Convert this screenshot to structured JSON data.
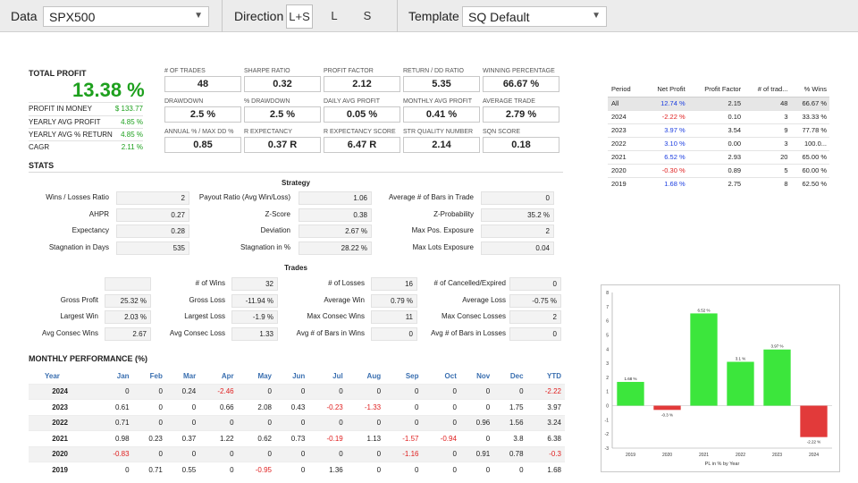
{
  "toolbar": {
    "data_label": "Data",
    "data_value": "SPX500",
    "direction_label": "Direction",
    "direction_options": [
      "L+S",
      "L",
      "S"
    ],
    "template_label": "Template",
    "template_value": "SQ Default"
  },
  "summary": {
    "total_profit_label": "TOTAL PROFIT",
    "total_profit_value": "13.38 %",
    "rows": [
      {
        "label": "PROFIT IN MONEY",
        "value": "$ 133.77"
      },
      {
        "label": "YEARLY AVG PROFIT",
        "value": "4.85 %"
      },
      {
        "label": "YEARLY AVG % RETURN",
        "value": "4.85 %"
      },
      {
        "label": "CAGR",
        "value": "2.11 %"
      }
    ]
  },
  "kpis": [
    {
      "label": "# OF TRADES",
      "value": "48"
    },
    {
      "label": "SHARPE RATIO",
      "value": "0.32"
    },
    {
      "label": "PROFIT FACTOR",
      "value": "2.12"
    },
    {
      "label": "RETURN / DD RATIO",
      "value": "5.35"
    },
    {
      "label": "WINNING PERCENTAGE",
      "value": "66.67 %"
    },
    {
      "label": "DRAWDOWN",
      "value": "2.5 %"
    },
    {
      "label": "% DRAWDOWN",
      "value": "2.5 %"
    },
    {
      "label": "DAILY AVG PROFIT",
      "value": "0.05 %"
    },
    {
      "label": "MONTHLY AVG PROFIT",
      "value": "0.41 %"
    },
    {
      "label": "AVERAGE TRADE",
      "value": "2.79 %"
    },
    {
      "label": "ANNUAL % / MAX DD %",
      "value": "0.85"
    },
    {
      "label": "R EXPECTANCY",
      "value": "0.37 R"
    },
    {
      "label": "R EXPECTANCY SCORE",
      "value": "6.47 R"
    },
    {
      "label": "STR QUALITY NUMBER",
      "value": "2.14"
    },
    {
      "label": "SQN SCORE",
      "value": "0.18"
    }
  ],
  "stats": {
    "title": "STATS",
    "strategy_title": "Strategy",
    "strategy": [
      [
        {
          "label": "Wins / Losses Ratio",
          "value": "2"
        },
        {
          "label": "Payout Ratio (Avg Win/Loss)",
          "value": "1.06"
        },
        {
          "label": "Average # of Bars in Trade",
          "value": "0"
        }
      ],
      [
        {
          "label": "AHPR",
          "value": "0.27"
        },
        {
          "label": "Z-Score",
          "value": "0.38"
        },
        {
          "label": "Z-Probability",
          "value": "35.2 %"
        }
      ],
      [
        {
          "label": "Expectancy",
          "value": "0.28"
        },
        {
          "label": "Deviation",
          "value": "2.67 %"
        },
        {
          "label": "Max Pos. Exposure",
          "value": "2"
        }
      ],
      [
        {
          "label": "Stagnation in Days",
          "value": "535"
        },
        {
          "label": "Stagnation in %",
          "value": "28.22 %"
        },
        {
          "label": "Max Lots Exposure",
          "value": "0.04"
        }
      ]
    ],
    "trades_title": "Trades",
    "trades": [
      [
        {
          "label": "",
          "value": ""
        },
        {
          "label": "# of Wins",
          "value": "32"
        },
        {
          "label": "# of Losses",
          "value": "16"
        },
        {
          "label": "# of Cancelled/Expired",
          "value": "0"
        }
      ],
      [
        {
          "label": "Gross Profit",
          "value": "25.32 %"
        },
        {
          "label": "Gross Loss",
          "value": "-11.94 %"
        },
        {
          "label": "Average Win",
          "value": "0.79 %"
        },
        {
          "label": "Average Loss",
          "value": "-0.75 %"
        }
      ],
      [
        {
          "label": "Largest Win",
          "value": "2.03 %"
        },
        {
          "label": "Largest Loss",
          "value": "-1.9 %"
        },
        {
          "label": "Max Consec Wins",
          "value": "11"
        },
        {
          "label": "Max Consec Losses",
          "value": "2"
        }
      ],
      [
        {
          "label": "Avg Consec Wins",
          "value": "2.67"
        },
        {
          "label": "Avg Consec Loss",
          "value": "1.33"
        },
        {
          "label": "Avg # of Bars in Wins",
          "value": "0"
        },
        {
          "label": "Avg # of Bars in Losses",
          "value": "0"
        }
      ]
    ]
  },
  "monthly": {
    "title": "MONTHLY PERFORMANCE (%)",
    "headers": [
      "Year",
      "Jan",
      "Feb",
      "Mar",
      "Apr",
      "May",
      "Jun",
      "Jul",
      "Aug",
      "Sep",
      "Oct",
      "Nov",
      "Dec",
      "YTD"
    ],
    "rows": [
      [
        "2024",
        "0",
        "0",
        "0.24",
        "-2.46",
        "0",
        "0",
        "0",
        "0",
        "0",
        "0",
        "0",
        "0",
        "-2.22"
      ],
      [
        "2023",
        "0.61",
        "0",
        "0",
        "0.66",
        "2.08",
        "0.43",
        "-0.23",
        "-1.33",
        "0",
        "0",
        "0",
        "1.75",
        "3.97"
      ],
      [
        "2022",
        "0.71",
        "0",
        "0",
        "0",
        "0",
        "0",
        "0",
        "0",
        "0",
        "0",
        "0.96",
        "1.56",
        "3.24"
      ],
      [
        "2021",
        "0.98",
        "0.23",
        "0.37",
        "1.22",
        "0.62",
        "0.73",
        "-0.19",
        "1.13",
        "-1.57",
        "-0.94",
        "0",
        "3.8",
        "6.38"
      ],
      [
        "2020",
        "-0.83",
        "0",
        "0",
        "0",
        "0",
        "0",
        "0",
        "0",
        "-1.16",
        "0",
        "0.91",
        "0.78",
        "-0.3"
      ],
      [
        "2019",
        "0",
        "0.71",
        "0.55",
        "0",
        "-0.95",
        "0",
        "1.36",
        "0",
        "0",
        "0",
        "0",
        "0",
        "1.68"
      ]
    ]
  },
  "yearly": {
    "headers": [
      "Period",
      "Net Profit",
      "Profit Factor",
      "# of trad...",
      "% Wins"
    ],
    "rows": [
      [
        "All",
        "12.74 %",
        "2.15",
        "48",
        "66.67 %"
      ],
      [
        "2024",
        "-2.22 %",
        "0.10",
        "3",
        "33.33 %"
      ],
      [
        "2023",
        "3.97 %",
        "3.54",
        "9",
        "77.78 %"
      ],
      [
        "2022",
        "3.10 %",
        "0.00",
        "3",
        "100.0..."
      ],
      [
        "2021",
        "6.52 %",
        "2.93",
        "20",
        "65.00 %"
      ],
      [
        "2020",
        "-0.30 %",
        "0.89",
        "5",
        "60.00 %"
      ],
      [
        "2019",
        "1.68 %",
        "2.75",
        "8",
        "62.50 %"
      ]
    ]
  },
  "chart_data": {
    "type": "bar",
    "categories": [
      "2019",
      "2020",
      "2021",
      "2022",
      "2023",
      "2024"
    ],
    "values": [
      1.68,
      -0.3,
      6.52,
      3.1,
      3.97,
      -2.22
    ],
    "data_labels": [
      "1.68 %",
      "-0.3 %",
      "6.52 %",
      "3.1 %",
      "3.97 %",
      "-2.22 %"
    ],
    "xlabel": "PL in % by Year",
    "ylim": [
      -3,
      8
    ],
    "yticks": [
      "-3",
      "-2",
      "-1",
      "0",
      "1",
      "2",
      "3",
      "4",
      "5",
      "6",
      "7",
      "8"
    ],
    "positive_color": "#3ce63c",
    "negative_color": "#e23a3a"
  }
}
